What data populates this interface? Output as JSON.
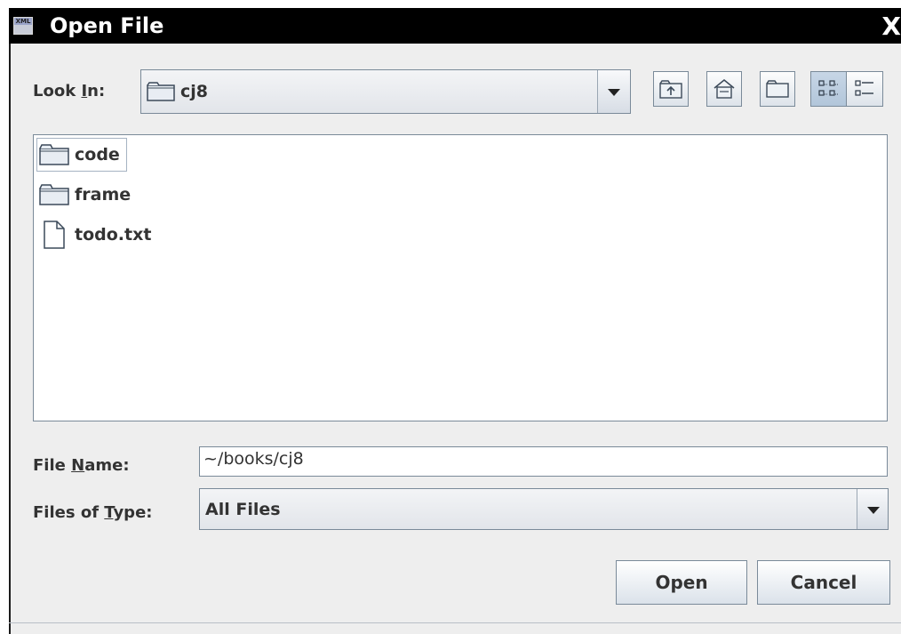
{
  "window": {
    "title": "Open File",
    "icon_label": "XML",
    "close_label": "X"
  },
  "look_in": {
    "label_prefix": "Look ",
    "label_mnemonic": "I",
    "label_suffix": "n:",
    "value": "cj8"
  },
  "toolbar": {
    "buttons": [
      "up-one-level",
      "home",
      "create-new-folder",
      "list-view",
      "details-view"
    ],
    "active_view": "list-view"
  },
  "files": [
    {
      "name": "code",
      "type": "folder"
    },
    {
      "name": "frame",
      "type": "folder"
    },
    {
      "name": "todo.txt",
      "type": "file"
    }
  ],
  "file_name": {
    "label_prefix": "File ",
    "label_mnemonic": "N",
    "label_suffix": "ame:",
    "value": "~/books/cj8"
  },
  "files_of_type": {
    "label_prefix": "Files of ",
    "label_mnemonic": "T",
    "label_suffix": "ype:",
    "value": "All Files"
  },
  "buttons": {
    "open": "Open",
    "cancel": "Cancel"
  },
  "colors": {
    "titlebar": "#000000",
    "dialog_bg": "#eeeeee",
    "border": "#7a8a99",
    "text": "#333333"
  }
}
